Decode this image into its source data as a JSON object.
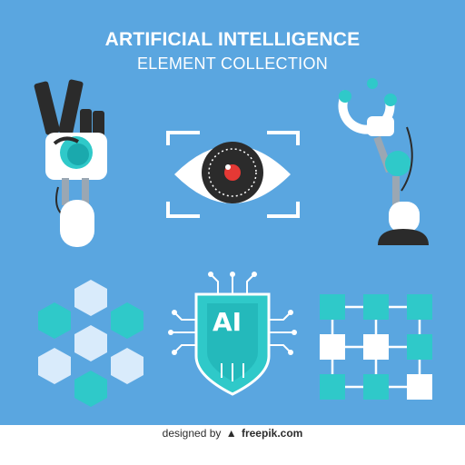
{
  "header": {
    "title": "ARTIFICIAL INTELLIGENCE",
    "subtitle": "ELEMENT COLLECTION"
  },
  "elements": {
    "ai_badge_text": "AI"
  },
  "footer": {
    "prefix": "designed by",
    "brand": "freepik.com"
  },
  "colors": {
    "background": "#5aa6e0",
    "teal": "#2fc9c9",
    "dark_teal": "#1aa9ad",
    "light_blue": "#d9ebfb",
    "dark": "#2b2b2b",
    "white": "#ffffff"
  },
  "icons": [
    "robot-hand-icon",
    "eye-scanner-icon",
    "robot-arm-icon",
    "hexagon-grid-icon",
    "ai-chip-shield-icon",
    "network-grid-icon"
  ]
}
